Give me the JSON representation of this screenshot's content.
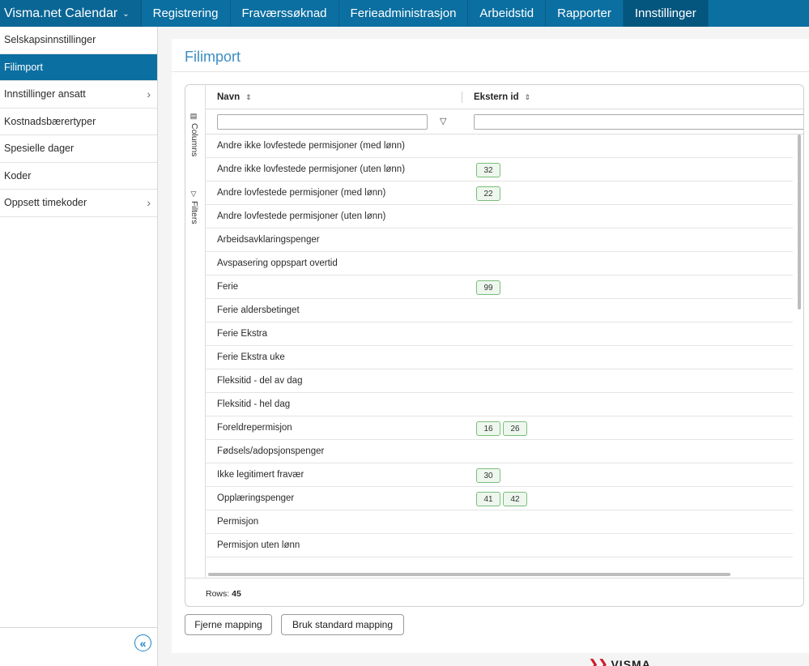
{
  "topnav": {
    "brand": "Visma.net Calendar",
    "items": [
      "Registrering",
      "Fraværssøknad",
      "Ferieadministrasjon",
      "Arbeidstid",
      "Rapporter",
      "Innstillinger"
    ],
    "active_index": 5
  },
  "sidebar": {
    "items": [
      {
        "label": "Selskapsinnstillinger",
        "has_children": false
      },
      {
        "label": "Filimport",
        "has_children": false,
        "active": true
      },
      {
        "label": "Innstillinger ansatt",
        "has_children": true
      },
      {
        "label": "Kostnadsbærertyper",
        "has_children": false
      },
      {
        "label": "Spesielle dager",
        "has_children": false
      },
      {
        "label": "Koder",
        "has_children": false
      },
      {
        "label": "Oppsett timekoder",
        "has_children": true
      }
    ]
  },
  "page": {
    "title": "Filimport"
  },
  "grid": {
    "side_tabs": {
      "columns": "Columns",
      "filters": "Filters"
    },
    "headers": {
      "name": "Navn",
      "external_id": "Ekstern id"
    },
    "filter_placeholders": {
      "name": "",
      "external_id": ""
    },
    "rows": [
      {
        "name": "Andre ikke lovfestede permisjoner (med lønn)",
        "ids": []
      },
      {
        "name": "Andre ikke lovfestede permisjoner (uten lønn)",
        "ids": [
          "32"
        ]
      },
      {
        "name": "Andre lovfestede permisjoner (med lønn)",
        "ids": [
          "22"
        ]
      },
      {
        "name": "Andre lovfestede permisjoner (uten lønn)",
        "ids": []
      },
      {
        "name": "Arbeidsavklaringspenger",
        "ids": []
      },
      {
        "name": "Avspasering oppspart overtid",
        "ids": []
      },
      {
        "name": "Ferie",
        "ids": [
          "99"
        ]
      },
      {
        "name": "Ferie aldersbetinget",
        "ids": []
      },
      {
        "name": "Ferie Ekstra",
        "ids": []
      },
      {
        "name": "Ferie Ekstra uke",
        "ids": []
      },
      {
        "name": "Fleksitid - del av dag",
        "ids": []
      },
      {
        "name": "Fleksitid - hel dag",
        "ids": []
      },
      {
        "name": "Foreldrepermisjon",
        "ids": [
          "16",
          "26"
        ]
      },
      {
        "name": "Fødsels/adopsjonspenger",
        "ids": []
      },
      {
        "name": "Ikke legitimert fravær",
        "ids": [
          "30"
        ]
      },
      {
        "name": "Opplæringspenger",
        "ids": [
          "41",
          "42"
        ]
      },
      {
        "name": "Permisjon",
        "ids": []
      },
      {
        "name": "Permisjon uten lønn",
        "ids": []
      }
    ],
    "footer": {
      "rows_label": "Rows:",
      "rows_count": "45"
    }
  },
  "actions": {
    "remove_mapping": "Fjerne mapping",
    "use_standard_mapping": "Bruk standard mapping"
  },
  "footer_logo": "VISMA",
  "colors": {
    "nav": "#0b6fa1",
    "accent": "#3c8dc4",
    "tag_border": "#7bbd7b"
  }
}
